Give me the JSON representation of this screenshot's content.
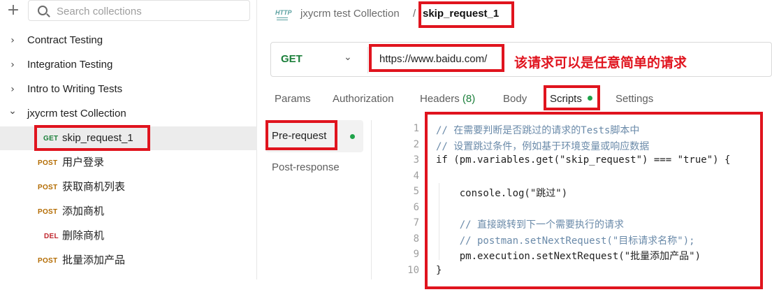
{
  "sidebar": {
    "search_placeholder": "Search collections",
    "collections": [
      {
        "label": "Contract Testing",
        "chevron": "›"
      },
      {
        "label": "Integration Testing",
        "chevron": "›"
      },
      {
        "label": "Intro to Writing Tests",
        "chevron": "›"
      },
      {
        "label": "jxycrm test Collection",
        "chevron": "⌄"
      }
    ],
    "requests": [
      {
        "method": "GET",
        "name": "skip_request_1"
      },
      {
        "method": "POST",
        "name": "用户登录"
      },
      {
        "method": "POST",
        "name": "获取商机列表"
      },
      {
        "method": "POST",
        "name": "添加商机"
      },
      {
        "method": "DEL",
        "name": "删除商机"
      },
      {
        "method": "POST",
        "name": "批量添加产品"
      }
    ]
  },
  "breadcrumb": {
    "icon_text": "HTTP",
    "collection": "jxycrm test Collection",
    "separator": "/",
    "request": "skip_request_1"
  },
  "urlbar": {
    "method": "GET",
    "url": "https://www.baidu.com/"
  },
  "annotation": "该请求可以是任意简单的请求",
  "tabs": {
    "params": "Params",
    "authorization": "Authorization",
    "headers": "Headers",
    "headers_count": "(8)",
    "body": "Body",
    "scripts": "Scripts",
    "settings": "Settings"
  },
  "scripts_nav": {
    "pre_request": "Pre-request",
    "post_response": "Post-response"
  },
  "editor": {
    "line_numbers": [
      "1",
      "2",
      "3",
      "4",
      "5",
      "6",
      "7",
      "8",
      "9",
      "10"
    ],
    "lines": [
      "// 在需要判断是否跳过的请求的Tests脚本中",
      "// 设置跳过条件，例如基于环境变量或响应数据",
      "if (pm.variables.get(\"skip_request\") === \"true\") {",
      "",
      "    console.log(\"跳过\")",
      "",
      "    // 直接跳转到下一个需要执行的请求",
      "    // postman.setNextRequest(\"目标请求名称\");",
      "    pm.execution.setNextRequest(\"批量添加产品\")",
      "}"
    ]
  },
  "colors": {
    "highlight_box": "#e0141e",
    "get": "#1b7f3a",
    "post": "#b36b00",
    "del": "#c0262d"
  }
}
